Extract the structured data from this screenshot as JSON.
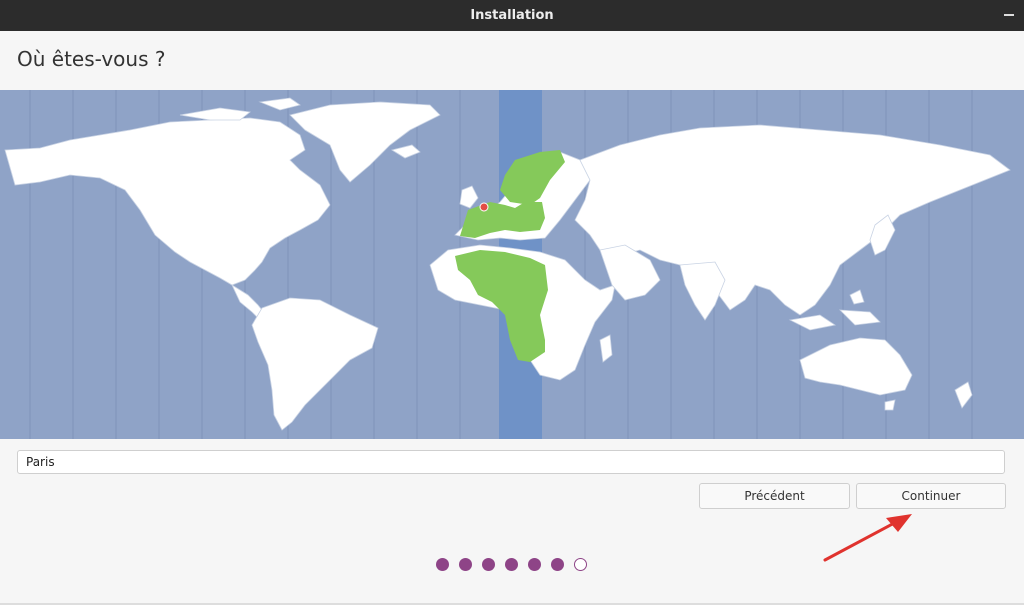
{
  "window": {
    "title": "Installation"
  },
  "page": {
    "heading": "Où êtes-vous ?"
  },
  "timezone": {
    "city_value": "Paris"
  },
  "buttons": {
    "back_label": "Précédent",
    "continue_label": "Continuer"
  },
  "progress": {
    "total_steps": 7,
    "current_step": 7
  },
  "colors": {
    "ocean": "#8fa3c7",
    "land": "#ffffff",
    "selected_zone": "#6f92c7",
    "selected_land": "#85c95a",
    "accent": "#8e4487",
    "arrow": "#e0332e"
  }
}
